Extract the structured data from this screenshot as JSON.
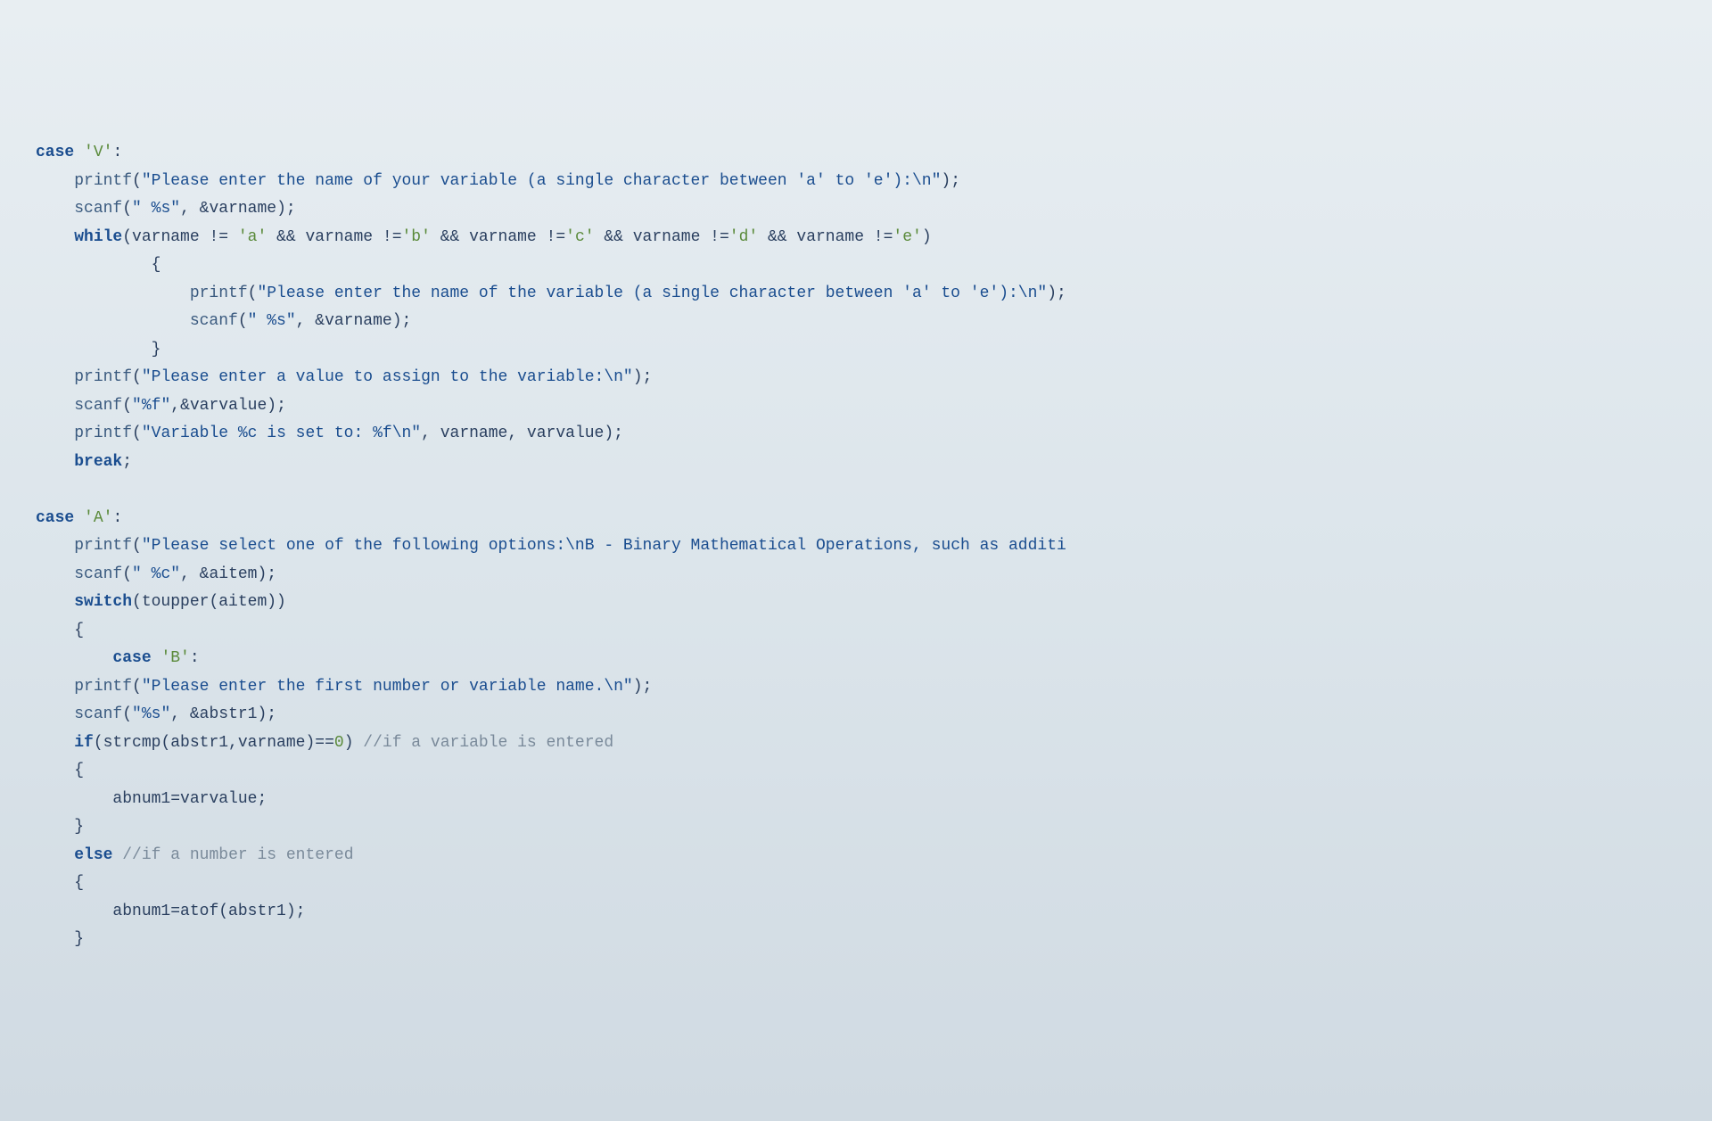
{
  "code": {
    "line1_kw": "case",
    "line1_chr": "'V'",
    "line1_colon": ":",
    "line2_fn": "printf",
    "line2_paren1": "(",
    "line2_str": "\"Please enter the name of your variable (a single character between 'a' to 'e'):\\n\"",
    "line2_end": ");",
    "line3_fn": "scanf",
    "line3_paren1": "(",
    "line3_str": "\" %s\"",
    "line3_rest": ", &varname);",
    "line4_kw": "while",
    "line4_paren": "(varname != ",
    "line4_chr_a": "'a'",
    "line4_and1": " && varname !=",
    "line4_chr_b": "'b'",
    "line4_and2": " && varname !=",
    "line4_chr_c": "'c'",
    "line4_and3": " && varname !=",
    "line4_chr_d": "'d'",
    "line4_and4": " && varname !=",
    "line4_chr_e": "'e'",
    "line4_end": ")",
    "line5_brace": "{",
    "line6_fn": "printf",
    "line6_paren1": "(",
    "line6_str": "\"Please enter the name of the variable (a single character between 'a' to 'e'):\\n\"",
    "line6_end": ");",
    "line7_fn": "scanf",
    "line7_paren1": "(",
    "line7_str": "\" %s\"",
    "line7_rest": ", &varname);",
    "line8_brace": "}",
    "line9_fn": "printf",
    "line9_paren1": "(",
    "line9_str": "\"Please enter a value to assign to the variable:\\n\"",
    "line9_end": ");",
    "line10_fn": "scanf",
    "line10_paren1": "(",
    "line10_str": "\"%f\"",
    "line10_rest": ",&varvalue);",
    "line11_fn": "printf",
    "line11_paren1": "(",
    "line11_str": "\"Variable %c is set to: %f\\n\"",
    "line11_rest": ", varname, varvalue);",
    "line12_kw": "break",
    "line12_end": ";",
    "line14_kw": "case",
    "line14_chr": "'A'",
    "line14_colon": ":",
    "line15_fn": "printf",
    "line15_paren1": "(",
    "line15_str": "\"Please select one of the following options:\\nB - Binary Mathematical Operations, such as additi",
    "line16_fn": "scanf",
    "line16_paren1": "(",
    "line16_str": "\" %c\"",
    "line16_rest": ", &aitem);",
    "line17_kw": "switch",
    "line17_rest": "(toupper(aitem))",
    "line18_brace": "{",
    "line19_kw": "case",
    "line19_chr": "'B'",
    "line19_colon": ":",
    "line20_fn": "printf",
    "line20_paren1": "(",
    "line20_str": "\"Please enter the first number or variable name.\\n\"",
    "line20_end": ");",
    "line21_fn": "scanf",
    "line21_paren1": "(",
    "line21_str": "\"%s\"",
    "line21_rest": ", &abstr1);",
    "line22_kw": "if",
    "line22_rest": "(strcmp(abstr1,varname)==",
    "line22_num": "0",
    "line22_end": ") ",
    "line22_cmt": "//if a variable is entered",
    "line23_brace": "{",
    "line24_stmt": "abnum1=varvalue;",
    "line25_brace": "}",
    "line26_kw": "else",
    "line26_sp": " ",
    "line26_cmt": "//if a number is entered",
    "line27_brace": "{",
    "line28_stmt": "abnum1=atof(abstr1);",
    "line29_brace": "}"
  }
}
